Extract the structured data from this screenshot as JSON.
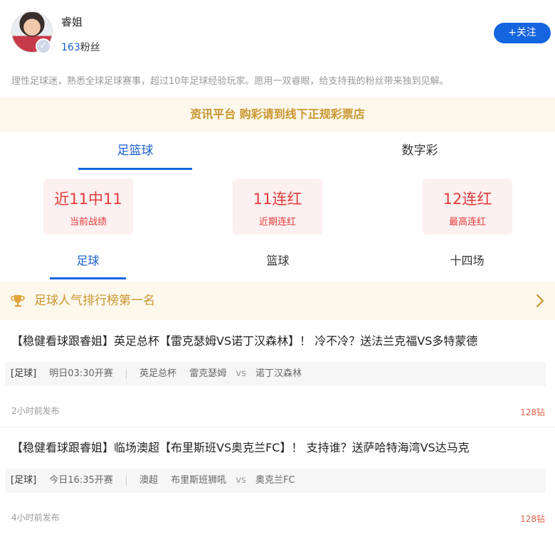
{
  "profile": {
    "name": "睿姐",
    "fans_count": "163",
    "fans_suffix": "粉丝",
    "follow_label": "+关注",
    "bio": "理性足球迷，熟悉全球足球赛事，超过10年足球经验玩家。愿用一双睿眼，给支持我的粉丝带来独到见解。"
  },
  "notice": "资讯平台 购彩请到线下正规彩票店",
  "main_tabs": [
    {
      "label": "足篮球",
      "active": true
    },
    {
      "label": "数字彩",
      "active": false
    }
  ],
  "stats": [
    {
      "value": "近11中11",
      "label": "当前战绩"
    },
    {
      "value": "11连红",
      "label": "近期连红"
    },
    {
      "value": "12连红",
      "label": "最高连红"
    }
  ],
  "sub_tabs": [
    {
      "label": "足球",
      "active": true
    },
    {
      "label": "篮球",
      "active": false
    },
    {
      "label": "十四场",
      "active": false
    }
  ],
  "ranking": {
    "label": "足球人气排行榜第一名",
    "icon": "trophy-icon"
  },
  "posts": [
    {
      "title": "【稳健看球跟睿姐】英足总杯【雷克瑟姆VS诺丁汉森林】！ 冷不冷？送法兰克福VS多特蒙德",
      "sport": "[足球]",
      "kickoff": "明日03:30开赛",
      "league": "英足总杯",
      "home": "雷克瑟姆",
      "vs": "vs",
      "away": "诺丁汉森林",
      "time": "2小时前发布",
      "price": "128钻"
    },
    {
      "title": "【稳健看球跟睿姐】临场澳超【布里斯班VS奥克兰FC】！ 支持谁？送萨哈特海湾VS达马克",
      "sport": "[足球]",
      "kickoff": "今日16:35开赛",
      "league": "澳超",
      "home": "布里斯班狮吼",
      "vs": "vs",
      "away": "奥克兰FC",
      "time": "4小时前发布",
      "price": "128钻"
    }
  ],
  "colors": {
    "accent": "#1565e0",
    "gold": "#c9962f",
    "red": "#e23a3a",
    "cream": "#fdf8ec"
  }
}
